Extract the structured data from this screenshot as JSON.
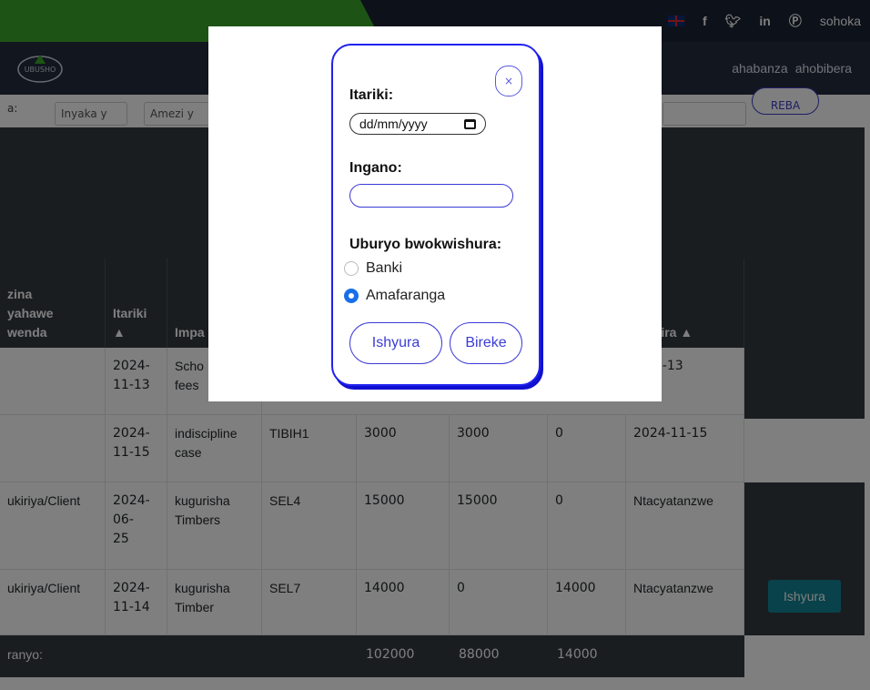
{
  "topbar": {
    "social": [
      {
        "icon": "facebook-icon",
        "glyph": "f"
      },
      {
        "icon": "twitter-icon",
        "glyph": "♥"
      },
      {
        "icon": "linkedin-icon",
        "glyph": "in"
      },
      {
        "icon": "pinterest-icon",
        "glyph": "℗"
      }
    ],
    "logout_label": "sohoka"
  },
  "navbar": {
    "logo_text": "UBUSHO",
    "links": [
      "ahabanza",
      "ahobibera"
    ]
  },
  "filters": {
    "label": "a:",
    "year_value": "Inyaka y",
    "month_value": "Amezi y",
    "search_button": "REBA"
  },
  "table": {
    "headers": [
      "zina\nyahawe\nwenda",
      "Itariki\n▲",
      "Impa",
      "",
      "",
      "",
      "",
      "e\nhyurira ▲"
    ],
    "rows": [
      [
        "",
        "2024-\n11-13",
        "Scho\nfees",
        "",
        "",
        "",
        "",
        "4-06-13"
      ],
      [
        "",
        "2024-\n11-15",
        "indiscipline\ncase",
        "TIBIH1",
        "3000",
        "3000",
        "0",
        "2024-11-15"
      ],
      [
        "ukiriya/Client",
        "2024-\n06-\n25",
        "kugurisha\nTimbers",
        "SEL4",
        "15000",
        "15000",
        "0",
        "Ntacyatanzwe"
      ],
      [
        "ukiriya/Client",
        "2024-\n11-14",
        "kugurisha\nTimber",
        "SEL7",
        "14000",
        "0",
        "14000",
        "Ntacyatanzwe"
      ]
    ],
    "pay_button": "Ishyura",
    "total_label": "ranyo:",
    "totals": [
      "102000",
      "88000",
      "14000"
    ]
  },
  "modal": {
    "close_label": "×",
    "date_label": "Itariki:",
    "date_placeholder": "dd/mm/yyyy",
    "amount_label": "Ingano:",
    "amount_value": "",
    "method_label": "Uburyo bwokwishura:",
    "methods": [
      {
        "label": "Banki",
        "selected": false
      },
      {
        "label": "Amafaranga",
        "selected": true
      }
    ],
    "pay_button": "Ishyura",
    "cancel_button": "Bireke"
  },
  "colors": {
    "brand_green": "#3aa82b",
    "navy": "#1b2235",
    "modal_accent": "#2222ee",
    "radio_selected": "#1a6fe8",
    "pay_teal": "#138496"
  }
}
